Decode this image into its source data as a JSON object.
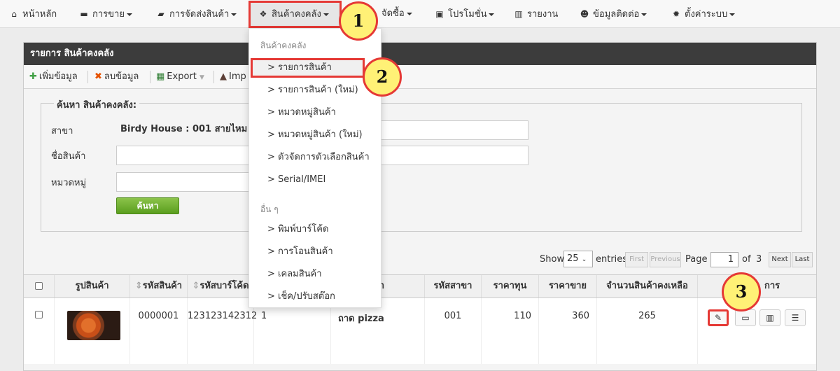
{
  "nav": {
    "home": "หน้าหลัก",
    "sales": "การขาย",
    "shipping": "การจัดส่งสินค้า",
    "inventory": "สินค้าคงคลัง",
    "purchase": "จัดซื้อ",
    "promotion": "โปรโมชั่น",
    "report": "รายงาน",
    "contacts": "ข้อมูลติดต่อ",
    "settings": "ตั้งค่าระบบ"
  },
  "dropdown": {
    "header1": "สินค้าคงคลัง",
    "items1": [
      "> รายการสินค้า",
      "> รายการสินค้า (ใหม่)",
      "> หมวดหมู่สินค้า",
      "> หมวดหมู่สินค้า (ใหม่)",
      "> ตัวจัดการตัวเลือกสินค้า",
      "> Serial/IMEI"
    ],
    "header2": "อื่น ๆ",
    "items2": [
      "> พิมพ์บาร์โค้ด",
      "> การโอนสินค้า",
      "> เคลมสินค้า",
      "> เช็ค/ปรับสต๊อก"
    ]
  },
  "panel": {
    "title": "รายการ สินค้าคงคลัง",
    "toolbar": {
      "add": "เพิ่มข้อมูล",
      "delete": "ลบข้อมูล",
      "export": "Export",
      "import": "Imp"
    },
    "search": {
      "legend": "ค้นหา สินค้าคงคลัง:",
      "branch_label": "สาขา",
      "branch_value": "Birdy House : 001 สายไหม",
      "name_label": "ชื่อสินค้า",
      "category_label": "หมวดหมู่",
      "button": "ค้นหา"
    }
  },
  "pager": {
    "show": "Show",
    "entries_value": "25",
    "entries": "entries",
    "first": "First",
    "previous": "Previous",
    "page": "Page",
    "page_value": "1",
    "of": "of",
    "total_pages": "3",
    "next": "Next",
    "last": "Last"
  },
  "table": {
    "headers": [
      "รูปสินค้า",
      "รหัสสินค้า",
      "รหัสบาร์โค้ด",
      "ค้า",
      "รหัสสาขา",
      "ราคาทุน",
      "ราคาขาย",
      "จำนวนสินค้าคงเหลือ",
      "การ"
    ],
    "row": {
      "code": "0000001",
      "barcode": "123123142312",
      "col4": "1",
      "name": "ถาด pizza",
      "branch": "001",
      "cost": "110",
      "price": "360",
      "stock": "265"
    }
  },
  "callouts": [
    "1",
    "2",
    "3"
  ]
}
